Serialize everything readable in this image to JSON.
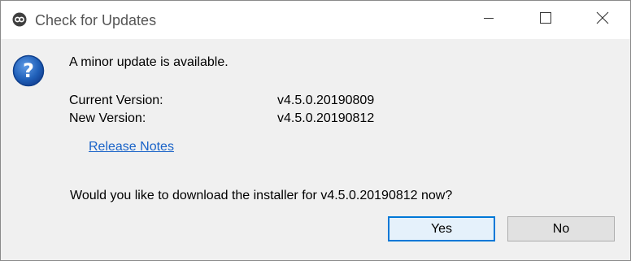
{
  "window": {
    "title": "Check for Updates",
    "app_icon": "eclipse-app-icon",
    "controls": [
      "minimize-icon",
      "maximize-icon",
      "close-icon"
    ]
  },
  "dialog": {
    "icon": "question-icon",
    "headline": "A minor update is available.",
    "current_version_label": "Current Version:",
    "current_version_value": "v4.5.0.20190809",
    "new_version_label": "New Version:",
    "new_version_value": "v4.5.0.20190812",
    "release_notes_link": "Release Notes",
    "question": "Would you like to download the installer for v4.5.0.20190812 now?"
  },
  "buttons": {
    "yes_label": "Yes",
    "no_label": "No"
  },
  "colors": {
    "link": "#1a63c8",
    "default_button_border": "#0078d7",
    "question_icon": "#1f5fb8"
  }
}
